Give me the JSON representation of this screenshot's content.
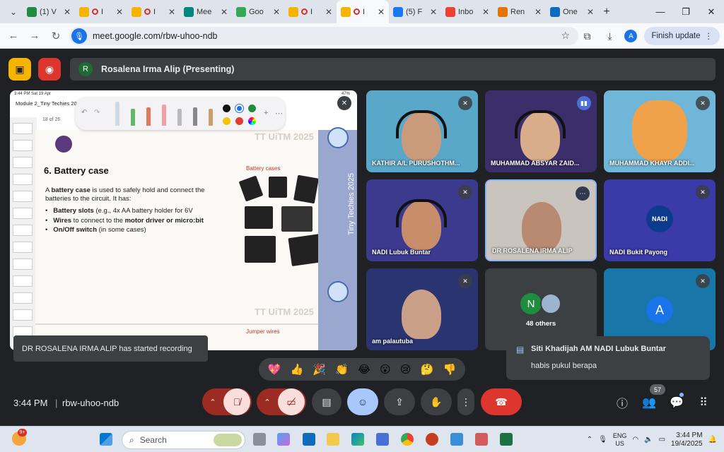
{
  "browser": {
    "tabs": [
      {
        "label": "(1) V",
        "color": "#1e8e3e"
      },
      {
        "label": "I",
        "color": "#f4b400",
        "rec": true
      },
      {
        "label": "I",
        "color": "#f4b400",
        "rec": true
      },
      {
        "label": "Mee",
        "color": "#00897b"
      },
      {
        "label": "Goo",
        "color": "#34a853"
      },
      {
        "label": "I",
        "color": "#f4b400",
        "rec": true
      },
      {
        "label": "I",
        "color": "#f4b400",
        "rec": true,
        "active": true
      },
      {
        "label": "(5) F",
        "color": "#1877f2"
      },
      {
        "label": "Inbo",
        "color": "#ea4335"
      },
      {
        "label": "Ren",
        "color": "#e37400"
      },
      {
        "label": "One",
        "color": "#0f6cbd"
      }
    ],
    "url": "meet.google.com/rbw-uhoo-ndb",
    "profile_initial": "A",
    "finish_update_label": "Finish update"
  },
  "meet": {
    "presenter_initial": "R",
    "presenting_banner": "Rosalena Irma Alip (Presenting)",
    "recording_toast": "DR ROSALENA IRMA ALIP has started recording",
    "chat_popup": {
      "sender": "Siti Khadijah AM NADI Lubuk Buntar",
      "message": "habis pukul berapa"
    },
    "reactions": [
      "💖",
      "👍",
      "🎉",
      "👏",
      "😂",
      "😮",
      "😢",
      "🤔",
      "👎"
    ],
    "time": "3:44 PM",
    "separator": "|",
    "meeting_code": "rbw-uhoo-ndb",
    "people_count": "57",
    "tiles": [
      {
        "name": "KATHIR A/L PURUSHOTHM...",
        "bg": "#5aa8c9",
        "mic": "muted"
      },
      {
        "name": "MUHAMMAD ABSYAR ZAID...",
        "bg": "#3a2f6b",
        "mic": "speaking"
      },
      {
        "name": "MUHAMMAD KHAYR ADDI...",
        "bg": "#6fb6d8",
        "mic": "muted"
      },
      {
        "name": "NADI Lubuk Buntar",
        "bg": "#3b3a8f",
        "mic": "muted"
      },
      {
        "name": "DR ROSALENA IRMA ALIP",
        "bg": "#c9c4bd",
        "mic": "more"
      },
      {
        "name": "NADI Bukit Payong",
        "bg": "#3a3aa8",
        "mic": "muted",
        "logo": "NADI"
      },
      {
        "name": "am palautuba",
        "bg": "#2a3470",
        "mic": "muted"
      },
      {
        "name": "",
        "bg": "#3c4043",
        "others": "48 others",
        "others_initial": "N"
      },
      {
        "name": "",
        "bg": "#1976a8",
        "avatar": "A",
        "mic": "muted"
      }
    ]
  },
  "presentation": {
    "status_time": "3:44 PM  Sat 19 Apr",
    "battery": "47%",
    "doc_title": "Module 2_Tiny Techies 2025",
    "page_indicator": "18 of 26",
    "slide_heading": "6. Battery case",
    "slide_intro_pre": "A ",
    "slide_intro_bold": "battery case",
    "slide_intro_post": " is used to safely hold and connect the batteries to the circuit. It has:",
    "bullet1_bold": "Battery slots",
    "bullet1_rest": " (e.g., 4x AA battery holder for 6V",
    "bullet2_bold": "Wires",
    "bullet2_mid": " to connect to the ",
    "bullet2_bold2": "motor driver or micro:bit",
    "bullet3_bold": "On/Off switch",
    "bullet3_rest": " (in some cases)",
    "cases_label": "Battery cases",
    "jumper_label": "Jumper wires",
    "watermark": "TT UiTM 2025",
    "vertical_text": "Tiny Techies 2025"
  },
  "taskbar": {
    "notification_count": "9+",
    "search_placeholder": "Search",
    "lang_top": "ENG",
    "lang_bottom": "US",
    "clock_time": "3:44 PM",
    "clock_date": "19/4/2025"
  },
  "colors": {
    "end_call": "#dc362e",
    "accent": "#1a73e8",
    "muted_red": "#9c2b23"
  }
}
